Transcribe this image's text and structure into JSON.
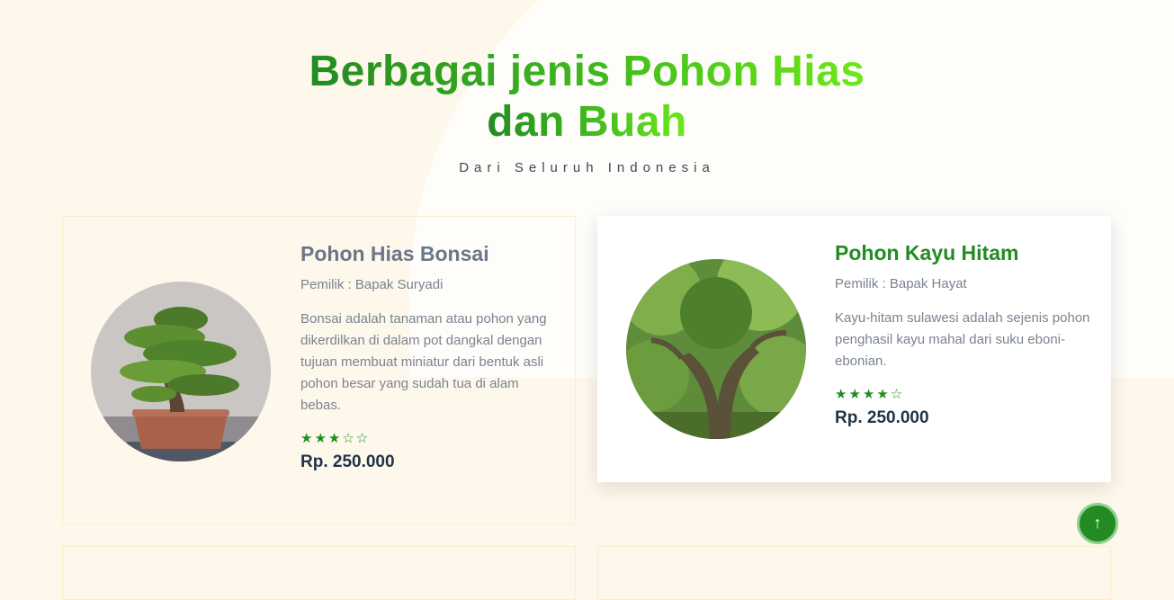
{
  "section": {
    "title_line1": "Berbagai jenis Pohon Hias",
    "title_line2": "dan Buah",
    "subtitle": "Dari Seluruh Indonesia"
  },
  "products": [
    {
      "name": "Pohon Hias Bonsai",
      "owner": "Pemilik : Bapak Suryadi",
      "description": "Bonsai adalah tanaman atau pohon yang dikerdilkan di dalam pot dangkal dengan tujuan membuat miniatur dari bentuk asli pohon besar yang sudah tua di alam bebas.",
      "rating": 3,
      "rating_max": 5,
      "stars": "★★★☆☆",
      "price": "Rp. 250.000",
      "image_icon": "bonsai-image"
    },
    {
      "name": "Pohon Kayu Hitam",
      "owner": "Pemilik : Bapak Hayat",
      "description": "Kayu-hitam sulawesi adalah sejenis pohon penghasil kayu mahal dari suku eboni-ebonian.",
      "rating": 4,
      "rating_max": 5,
      "stars": "★★★★☆",
      "price": "Rp. 250.000",
      "image_icon": "ebony-tree-image"
    }
  ],
  "back_to_top": {
    "icon": "arrow-up-icon",
    "glyph": "↑"
  },
  "colors": {
    "accent": "#228b22",
    "background": "#fef8ec",
    "price": "#1f3448"
  }
}
